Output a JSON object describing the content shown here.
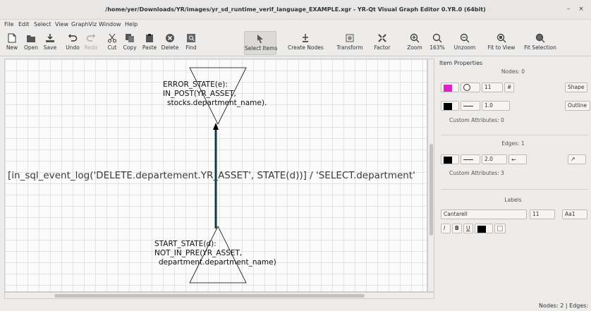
{
  "window": {
    "title": "/home/yer/Downloads/YR/images/yr_sd_runtime_verif_language_EXAMPLE.xgr - YR-Qt Visual Graph Editor 0.YR.0 (64bit)",
    "min_glyph": "–",
    "close_glyph": "×"
  },
  "menu": [
    "File",
    "Edit",
    "Select",
    "View",
    "GraphViz",
    "Window",
    "Help"
  ],
  "toolbar": {
    "new": "New",
    "open": "Open",
    "save": "Save",
    "undo": "Undo",
    "redo": "Redo",
    "cut": "Cut",
    "copy": "Copy",
    "paste": "Paste",
    "delete": "Delete",
    "find": "Find",
    "select_items": "Select Items",
    "create_nodes": "Create Nodes",
    "transform": "Transform",
    "factor": "Factor",
    "zoom": "Zoom",
    "zoom_level": "163%",
    "unzoom": "Unzoom",
    "fit_to_view": "Fit to View",
    "fit_selection": "Fit Selection"
  },
  "graph": {
    "top_node": {
      "line1": "ERROR_STATE(e):",
      "line2": "IN_POST(YR_ASSET,",
      "line3": "stocks.department_name)."
    },
    "bottom_node": {
      "line1": "START_STATE(d):",
      "line2": "NOT_IN_PRE(YR_ASSET,",
      "line3": "department.department_name)"
    },
    "edge_label": "[in_sql_event_log('DELETE.departement.YR_ASSET', STATE(d))] / 'SELECT.department'"
  },
  "panel": {
    "title": "Item Properties",
    "nodes_header": "Nodes: 0",
    "node_size": "11",
    "shape_btn": "Shape",
    "node_stroke": "1.0",
    "outline_btn": "Outline",
    "node_custom_attrs": "Custom Attributes: 0",
    "edges_header": "Edges: 1",
    "edge_stroke": "2.0",
    "edge_custom_attrs": "Custom Attributes: 3",
    "labels_header": "Labels",
    "font_name": "Cantarell",
    "font_size": "11",
    "font_sample": "Aa1",
    "italic": "I",
    "bold": "B",
    "underline": "U"
  },
  "colors": {
    "node_fill": "#e020c8",
    "node_stroke": "#000000",
    "edge_color": "#000000",
    "label_color": "#000000",
    "edge_line": "#0c3a40"
  },
  "status": "Nodes: 2 | Edges:"
}
